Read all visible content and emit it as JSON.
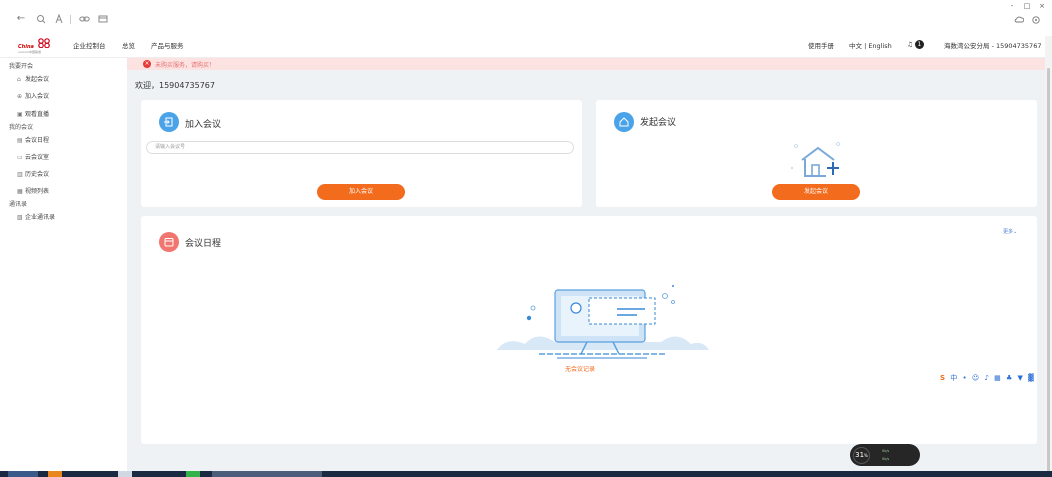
{
  "browser": {
    "win_min": "-",
    "win_max": "□",
    "win_close": "×",
    "back_glyph": "←",
    "nav_icons": [
      "search-icon",
      "font-icon",
      "link-icon",
      "tab-icon"
    ]
  },
  "header": {
    "logo_text": "China",
    "logo_sub": "unicom中国联通",
    "nav": [
      "企业控制台",
      "总览",
      "产品与服务"
    ],
    "manual": "使用手册",
    "lang": "中文 | English",
    "notif_count": "1",
    "account": "海数湾公安分局 - 15904735767"
  },
  "sidebar": {
    "groups": [
      {
        "title": "我要开会",
        "items": [
          {
            "icon": "⌂",
            "label": "发起会议"
          },
          {
            "icon": "⊕",
            "label": "加入会议"
          },
          {
            "icon": "▣",
            "label": "观看直播"
          }
        ]
      },
      {
        "title": "我的会议",
        "items": [
          {
            "icon": "▤",
            "label": "会议日程"
          },
          {
            "icon": "▭",
            "label": "云会议室"
          },
          {
            "icon": "▥",
            "label": "历史会议"
          },
          {
            "icon": "▦",
            "label": "视频列表"
          }
        ]
      },
      {
        "title": "通讯录",
        "items": [
          {
            "icon": "▧",
            "label": "企业通讯录"
          }
        ]
      }
    ]
  },
  "main": {
    "alert_text": "未购买服务，请购买！",
    "welcome": "欢迎，15904735767",
    "join": {
      "title": "加入会议",
      "placeholder": "请输入会议号",
      "button": "加入会议"
    },
    "start": {
      "title": "发起会议",
      "button": "发起会议"
    },
    "schedule": {
      "title": "会议日程",
      "more": "更多",
      "empty": "无会议记录"
    }
  },
  "speed": {
    "value": "31",
    "unit": "%",
    "up": "0k/s",
    "down": "0k/s"
  },
  "colors": {
    "accent": "#f36b1c",
    "join_icon": "#4aa3e8",
    "start_icon": "#4aa3e8",
    "schedule_icon": "#f0766f"
  }
}
